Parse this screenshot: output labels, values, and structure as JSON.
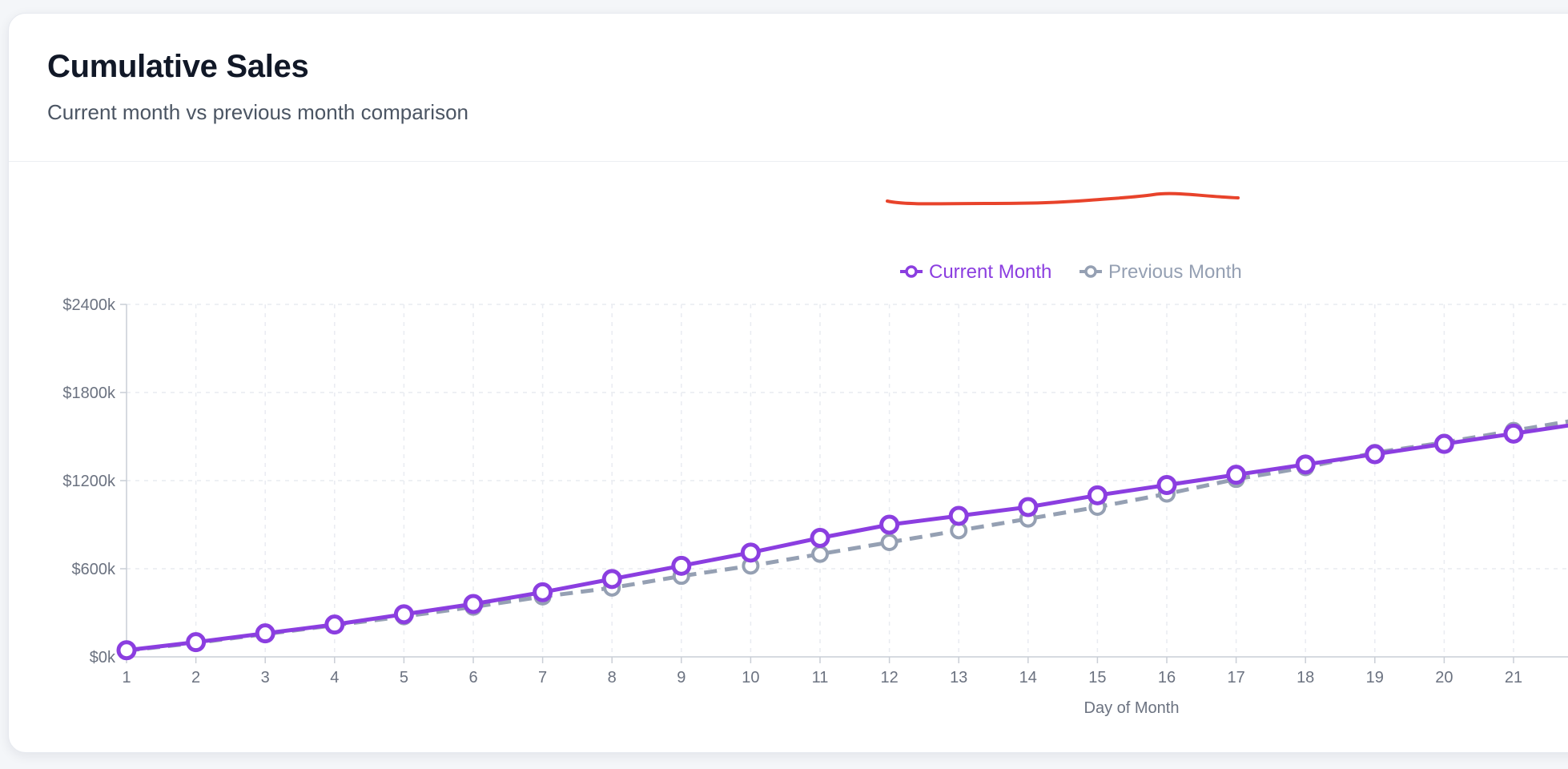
{
  "card": {
    "title": "Cumulative Sales",
    "subtitle": "Current month vs previous month comparison"
  },
  "colors": {
    "current": "#8b3ee0",
    "previous": "#95a0b3",
    "annotation": "#e8432b",
    "grid": "#e9ecf1",
    "axis": "#c9ced6",
    "tick_text": "#6b7280"
  },
  "chart_data": {
    "type": "line",
    "title": "Cumulative Sales",
    "subtitle": "Current month vs previous month comparison",
    "xlabel": "Day of Month",
    "ylabel": "",
    "ylim": [
      0,
      2400
    ],
    "y_unit": "thousand dollars",
    "y_ticks": [
      0,
      600,
      1200,
      1800,
      2400
    ],
    "y_tick_labels": [
      "$0k",
      "$600k",
      "$1200k",
      "$1800k",
      "$2400k"
    ],
    "x": [
      1,
      2,
      3,
      4,
      5,
      6,
      7,
      8,
      9,
      10,
      11,
      12,
      13,
      14,
      15,
      16,
      17,
      18,
      19,
      20,
      21
    ],
    "x_tick_labels": [
      "1",
      "2",
      "3",
      "4",
      "5",
      "6",
      "7",
      "8",
      "9",
      "10",
      "11",
      "12",
      "13",
      "14",
      "15",
      "16",
      "17",
      "18",
      "19",
      "20",
      "21"
    ],
    "grid": true,
    "legend_position": "top-center",
    "series": [
      {
        "name": "Current Month",
        "style": "solid",
        "values": [
          45,
          100,
          160,
          220,
          290,
          360,
          440,
          530,
          620,
          710,
          810,
          900,
          960,
          1020,
          1100,
          1170,
          1240,
          1310,
          1380,
          1450,
          1520
        ]
      },
      {
        "name": "Previous Month",
        "style": "dashed",
        "values": [
          42,
          95,
          155,
          215,
          275,
          340,
          410,
          470,
          550,
          620,
          700,
          780,
          860,
          940,
          1020,
          1110,
          1210,
          1290,
          1390,
          1460,
          1540
        ]
      }
    ]
  }
}
